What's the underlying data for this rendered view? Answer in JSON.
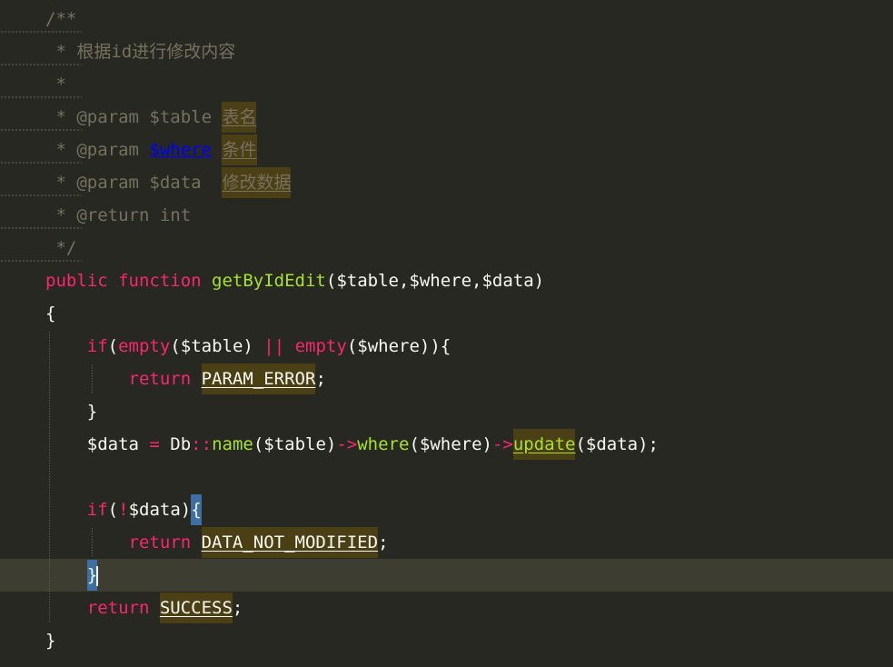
{
  "editor": {
    "lines": [
      {
        "segments": [
          {
            "t": "/**",
            "c": "comment"
          }
        ]
      },
      {
        "segments": [
          {
            "t": " * 根据id进行修改内容",
            "c": "comment"
          }
        ]
      },
      {
        "segments": [
          {
            "t": " *",
            "c": "comment"
          }
        ]
      },
      {
        "segments": [
          {
            "t": " * @param $table ",
            "c": "comment"
          },
          {
            "t": "表名",
            "c": "comment hl"
          }
        ]
      },
      {
        "segments": [
          {
            "t": " * @param ",
            "c": "comment"
          },
          {
            "t": "$where",
            "c": "link"
          },
          {
            "t": " ",
            "c": "comment"
          },
          {
            "t": "条件",
            "c": "comment hl"
          }
        ]
      },
      {
        "segments": [
          {
            "t": " * @param $data  ",
            "c": "comment"
          },
          {
            "t": "修改数据",
            "c": "comment hl"
          }
        ]
      },
      {
        "segments": [
          {
            "t": " * @return int",
            "c": "comment"
          }
        ]
      },
      {
        "segments": [
          {
            "t": " */",
            "c": "comment"
          }
        ]
      },
      {
        "segments": [
          {
            "t": "public ",
            "c": "kw"
          },
          {
            "t": "function ",
            "c": "kw"
          },
          {
            "t": "getByIdEdit",
            "c": "fn"
          },
          {
            "t": "($table,$where,$data)",
            "c": "text"
          }
        ]
      },
      {
        "segments": [
          {
            "t": "{",
            "c": "text"
          }
        ]
      },
      {
        "segments": [
          {
            "t": "    ",
            "c": "text"
          },
          {
            "t": "if",
            "c": "kw"
          },
          {
            "t": "(",
            "c": "text"
          },
          {
            "t": "empty",
            "c": "kw"
          },
          {
            "t": "($table) ",
            "c": "text"
          },
          {
            "t": "||",
            "c": "op"
          },
          {
            "t": " ",
            "c": "text"
          },
          {
            "t": "empty",
            "c": "kw"
          },
          {
            "t": "($where)){",
            "c": "text"
          }
        ]
      },
      {
        "segments": [
          {
            "t": "        ",
            "c": "text"
          },
          {
            "t": "return ",
            "c": "kw"
          },
          {
            "t": "PARAM_ERROR",
            "c": "const hl"
          },
          {
            "t": ";",
            "c": "text"
          }
        ]
      },
      {
        "segments": [
          {
            "t": "    }",
            "c": "text"
          }
        ]
      },
      {
        "segments": [
          {
            "t": "    $data ",
            "c": "text"
          },
          {
            "t": "=",
            "c": "op"
          },
          {
            "t": " Db",
            "c": "text"
          },
          {
            "t": "::",
            "c": "op"
          },
          {
            "t": "name",
            "c": "fn"
          },
          {
            "t": "($table)",
            "c": "text"
          },
          {
            "t": "->",
            "c": "op"
          },
          {
            "t": "where",
            "c": "fn"
          },
          {
            "t": "($where)",
            "c": "text"
          },
          {
            "t": "->",
            "c": "op"
          },
          {
            "t": "update",
            "c": "fn hl"
          },
          {
            "t": "($data);",
            "c": "text"
          }
        ]
      },
      {
        "segments": [
          {
            "t": "",
            "c": "text"
          }
        ]
      },
      {
        "segments": [
          {
            "t": "    ",
            "c": "text"
          },
          {
            "t": "if",
            "c": "kw"
          },
          {
            "t": "(",
            "c": "text"
          },
          {
            "t": "!",
            "c": "op"
          },
          {
            "t": "$data)",
            "c": "text"
          },
          {
            "t": "{",
            "c": "brace"
          }
        ]
      },
      {
        "segments": [
          {
            "t": "        ",
            "c": "text"
          },
          {
            "t": "return ",
            "c": "kw"
          },
          {
            "t": "DATA_NOT_MODIFIED",
            "c": "const hl"
          },
          {
            "t": ";",
            "c": "text"
          }
        ]
      },
      {
        "segments": [
          {
            "t": "    ",
            "c": "text"
          },
          {
            "t": "}",
            "c": "brace caret"
          }
        ],
        "current": true
      },
      {
        "segments": [
          {
            "t": "    ",
            "c": "text"
          },
          {
            "t": "return ",
            "c": "kw"
          },
          {
            "t": "SUCCESS",
            "c": "const hl"
          },
          {
            "t": ";",
            "c": "text"
          }
        ]
      },
      {
        "segments": [
          {
            "t": "}",
            "c": "text"
          }
        ]
      }
    ]
  },
  "colors": {
    "background": "#272822",
    "current_line": "#3e3d32",
    "comment": "#75715e",
    "keyword": "#f92672",
    "function": "#a6e22e",
    "text": "#f8f8f2",
    "link": "#0000ff",
    "highlight": "#4b3f16",
    "brace_match": "#3d6fa3"
  }
}
